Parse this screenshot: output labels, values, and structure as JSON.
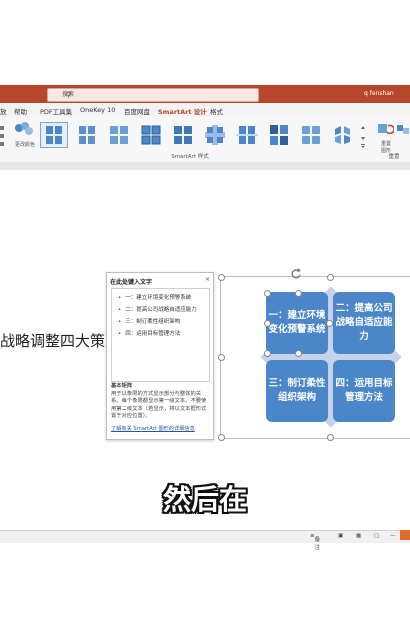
{
  "titlebar": {
    "search_placeholder": "搜索",
    "user": "q fenshan"
  },
  "tabs": [
    {
      "label": "放"
    },
    {
      "label": "帮助"
    },
    {
      "label": "PDF工具集"
    },
    {
      "label": "OneKey 10"
    },
    {
      "label": "百度网盘"
    },
    {
      "label": "SmartArt 设计"
    },
    {
      "label": "格式"
    }
  ],
  "ribbon": {
    "left_button": "更改颜色",
    "group_label": "SmartArt 样式",
    "reset_button": "重置\n图形",
    "reset_group": "重置"
  },
  "slide": {
    "left_text": "战略调整四大策"
  },
  "text_pane": {
    "title": "在此处键入文字",
    "close": "×",
    "items": [
      "一：建立环境变化预警系统",
      "二：提高公司战略自适应能力",
      "三：制订柔性组织架构",
      "四：运用目标管理方法"
    ],
    "desc_title": "基本矩阵",
    "desc": "用于以象限的方式显示部分与整体的关系。每个象限都显示第一级文本。不要使用第二级文本（若显示，将以文本框形式置于对应位置）。",
    "link": "了解有关 SmartArt 图形的详细信息"
  },
  "smartart": {
    "quadrants": [
      "一：建立环境变化预警系统",
      "二：提高公司战略自适应能力",
      "三：制订柔性组织架构",
      "四：运用目标管理方法"
    ],
    "colors": {
      "box": "#4a86c8",
      "diamond": "#c6d2ec"
    }
  },
  "caption": "然后在",
  "statusbar": {
    "notes": "备注",
    "zoom": "—"
  }
}
